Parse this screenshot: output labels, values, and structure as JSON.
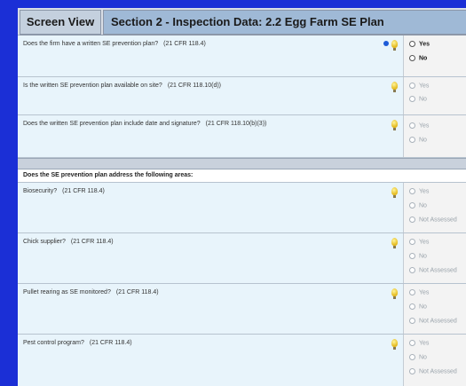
{
  "tabs": {
    "screen_view": "Screen View",
    "section": "Section 2 - Inspection Data: 2.2 Egg Farm SE Plan"
  },
  "questions_top": [
    {
      "text": "Does the firm have a written SE prevention plan?",
      "ref": "(21 CFR 118.4)",
      "options": [
        "Yes",
        "No"
      ],
      "active": true
    },
    {
      "text": "Is the written SE prevention plan available on site?",
      "ref": "(21 CFR 118.10(d))",
      "options": [
        "Yes",
        "No"
      ],
      "active": false
    },
    {
      "text": "Does the written SE prevention plan include date and signature?",
      "ref": "(21 CFR 118.10(b)(3))",
      "options": [
        "Yes",
        "No"
      ],
      "active": false
    }
  ],
  "section_heading": "Does the SE prevention plan address the following areas:",
  "questions_areas": [
    {
      "text": "Biosecurity?",
      "ref": "(21 CFR 118.4)",
      "options": [
        "Yes",
        "No",
        "Not Assessed"
      ]
    },
    {
      "text": "Chick supplier?",
      "ref": "(21 CFR 118.4)",
      "options": [
        "Yes",
        "No",
        "Not Assessed"
      ]
    },
    {
      "text": "Pullet rearing as SE monitored?",
      "ref": "(21 CFR 118.4)",
      "options": [
        "Yes",
        "No",
        "Not Assessed"
      ]
    },
    {
      "text": "Pest control program?",
      "ref": "(21 CFR 118.4)",
      "options": [
        "Yes",
        "No",
        "Not Assessed"
      ]
    }
  ],
  "colors": {
    "background": "#1b2fd6",
    "row": "#e8f4fb",
    "tab_active": "#9fb9d6"
  },
  "icons": {
    "hint": "lightbulb-icon",
    "status": "info-dot-icon"
  }
}
